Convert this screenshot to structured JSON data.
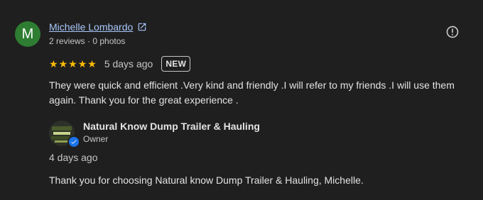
{
  "reviewer": {
    "initial": "M",
    "name": "Michelle Lombardo",
    "meta": "2 reviews · 0 photos",
    "avatar_color": "#2e7d32"
  },
  "review": {
    "rating": 5,
    "time": "5 days ago",
    "badge": "NEW",
    "text": "They were quick and efficient .Very kind and friendly .I will refer to my friends .I will use them again. Thank you for the great experience ."
  },
  "owner_reply": {
    "name": "Natural Know Dump Trailer & Hauling",
    "role": "Owner",
    "time": "4 days ago",
    "text": "Thank you for choosing Natural know Dump Trailer & Hauling, Michelle."
  },
  "colors": {
    "background": "#1f1f1f",
    "link": "#a8c7fa",
    "star": "#fbbc04",
    "verified": "#1a73e8"
  },
  "icons": [
    "open-in-new-icon",
    "report-icon",
    "star-icon",
    "verified-check-icon"
  ]
}
